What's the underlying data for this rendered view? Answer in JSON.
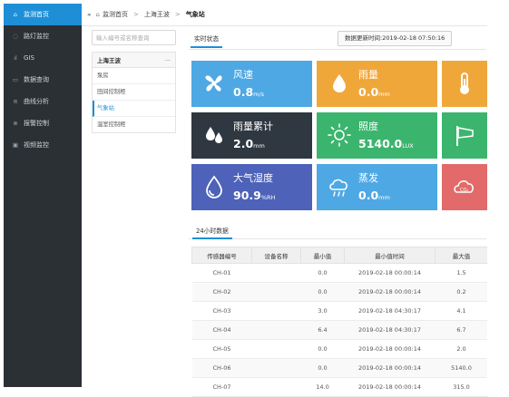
{
  "sidebar": {
    "items": [
      {
        "label": "监测首页",
        "icon": "home-icon"
      },
      {
        "label": "路灯监控",
        "icon": "lightbulb-icon"
      },
      {
        "label": "GIS",
        "icon": "signal-icon"
      },
      {
        "label": "数据查询",
        "icon": "database-icon"
      },
      {
        "label": "曲线分析",
        "icon": "chart-icon"
      },
      {
        "label": "报警控制",
        "icon": "alarm-icon"
      },
      {
        "label": "视频监控",
        "icon": "video-icon"
      }
    ]
  },
  "breadcrumb": {
    "items": [
      "监测首页",
      "上海王波",
      "气象站"
    ]
  },
  "devices": {
    "search_placeholder": "输入编号或名称查询",
    "group_title": "上海王波",
    "group_toggle": "—",
    "items": [
      "泵房",
      "田间控制柜",
      "气象站",
      "温室控制柜"
    ]
  },
  "realtime": {
    "tab": "实时状态",
    "update_time": "数据更新时间:2019-02-18 07:50:16"
  },
  "cards": [
    {
      "label": "风速",
      "value": "0.8",
      "unit": "m/s",
      "color": "#4ea8e4",
      "icon": "fan-icon"
    },
    {
      "label": "雨量",
      "value": "0.0",
      "unit": "mm",
      "color": "#f0a73a",
      "icon": "raindrop-icon"
    },
    {
      "label": "",
      "value": "",
      "unit": "",
      "color": "#f0a73a",
      "icon": "thermometer-icon"
    },
    {
      "label": "雨量累计",
      "value": "2.0",
      "unit": "mm",
      "color": "#2f3740",
      "icon": "raindrops-icon"
    },
    {
      "label": "照度",
      "value": "5140.0",
      "unit": "LUX",
      "color": "#3bb56e",
      "icon": "sun-icon"
    },
    {
      "label": "",
      "value": "",
      "unit": "",
      "color": "#3bb56e",
      "icon": "windsock-icon"
    },
    {
      "label": "大气湿度",
      "value": "90.9",
      "unit": "%RH",
      "color": "#4d62b8",
      "icon": "humidity-icon"
    },
    {
      "label": "蒸发",
      "value": "0.0",
      "unit": "mm",
      "color": "#4ea8e4",
      "icon": "cloud-rain-icon"
    },
    {
      "label": "",
      "value": "",
      "unit": "",
      "color": "#e36a6a",
      "icon": "co2-cloud-icon"
    }
  ],
  "h24": {
    "tab": "24小时数据",
    "columns": [
      "传感器编号",
      "设备名称",
      "最小值",
      "最小值时间",
      "最大值"
    ],
    "rows": [
      [
        "CH-01",
        "",
        "0.0",
        "2019-02-18 00:00:14",
        "1.5"
      ],
      [
        "CH-02",
        "",
        "0.0",
        "2019-02-18 00:00:14",
        "0.2"
      ],
      [
        "CH-03",
        "",
        "3.0",
        "2019-02-18 04:30:17",
        "4.1"
      ],
      [
        "CH-04",
        "",
        "6.4",
        "2019-02-18 04:30:17",
        "6.7"
      ],
      [
        "CH-05",
        "",
        "0.0",
        "2019-02-18 00:00:14",
        "2.0"
      ],
      [
        "CH-06",
        "",
        "0.0",
        "2019-02-18 00:00:14",
        "5140.0"
      ],
      [
        "CH-07",
        "",
        "14.0",
        "2019-02-18 00:00:14",
        "315.0"
      ]
    ]
  }
}
